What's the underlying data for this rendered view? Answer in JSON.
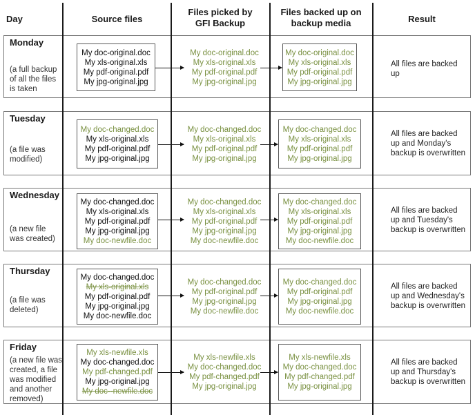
{
  "headers": {
    "day": "Day",
    "source": "Source files",
    "picked_line1": "Files picked by",
    "picked_line2": "GFI Backup",
    "backed_line1": "Files backed up on",
    "backed_line2": "backup media",
    "result": "Result"
  },
  "colors": {
    "unchanged": "#111111",
    "changed": "#7a9142",
    "border": "#777777"
  },
  "rows": [
    {
      "day": "Monday",
      "desc": [
        "(a full backup",
        "of all the files",
        "is taken"
      ],
      "source": [
        {
          "name": "My doc-original.doc",
          "state": "black"
        },
        {
          "name": "My xls-original.xls",
          "state": "black"
        },
        {
          "name": "My pdf-original.pdf",
          "state": "black"
        },
        {
          "name": "My jpg-original.jpg",
          "state": "black"
        }
      ],
      "picked": [
        "My doc-original.doc",
        "My xls-original.xls",
        "My pdf-original.pdf",
        "My jpg-original.jpg"
      ],
      "backed": [
        "My doc-original.doc",
        "My xls-original.xls",
        "My pdf-original.pdf",
        "My jpg-original.jpg"
      ],
      "result": [
        "All files are backed",
        "up"
      ]
    },
    {
      "day": "Tuesday",
      "desc": [
        "(a file was",
        "modified)"
      ],
      "source": [
        {
          "name": "My doc-changed.doc",
          "state": "green"
        },
        {
          "name": "My xls-original.xls",
          "state": "black"
        },
        {
          "name": "My pdf-original.pdf",
          "state": "black"
        },
        {
          "name": "My jpg-original.jpg",
          "state": "black"
        }
      ],
      "picked": [
        "My doc-changed.doc",
        "My xls-original.xls",
        "My pdf-original.pdf",
        "My jpg-original.jpg"
      ],
      "backed": [
        "My doc-changed.doc",
        "My xls-original.xls",
        "My pdf-original.pdf",
        "My jpg-original.jpg"
      ],
      "result": [
        "All files are backed",
        "up and Monday's",
        "backup is overwritten"
      ]
    },
    {
      "day": "Wednesday",
      "desc": [
        "(a new file",
        "was created)"
      ],
      "source": [
        {
          "name": "My doc-changed.doc",
          "state": "black"
        },
        {
          "name": "My xls-original.xls",
          "state": "black"
        },
        {
          "name": "My pdf-original.pdf",
          "state": "black"
        },
        {
          "name": "My jpg-original.jpg",
          "state": "black"
        },
        {
          "name": "My doc-newfile.doc",
          "state": "green"
        }
      ],
      "picked": [
        "My doc-changed.doc",
        "My xls-original.xls",
        "My pdf-original.pdf",
        "My jpg-original.jpg",
        "My doc-newfile.doc"
      ],
      "backed": [
        "My doc-changed.doc",
        "My xls-original.xls",
        "My pdf-original.pdf",
        "My jpg-original.jpg",
        "My doc-newfile.doc"
      ],
      "result": [
        "All files are backed",
        "up and Tuesday's",
        "backup is overwritten"
      ]
    },
    {
      "day": "Thursday",
      "desc": [
        "(a file was",
        "deleted)"
      ],
      "source": [
        {
          "name": "My doc-changed.doc",
          "state": "black"
        },
        {
          "name": "My xls-original.xls",
          "state": "struck"
        },
        {
          "name": "My pdf-original.pdf",
          "state": "black"
        },
        {
          "name": "My jpg-original.jpg",
          "state": "black"
        },
        {
          "name": "My doc-newfile.doc",
          "state": "black"
        }
      ],
      "picked": [
        "My doc-changed.doc",
        "My pdf-original.pdf",
        "My jpg-original.jpg",
        "My doc-newfile.doc"
      ],
      "backed": [
        "My doc-changed.doc",
        "My pdf-original.pdf",
        "My jpg-original.jpg",
        "My doc-newfile.doc"
      ],
      "result": [
        "All files are backed",
        "up and Wednesday's",
        "backup is overwritten"
      ]
    },
    {
      "day": "Friday",
      "desc": [
        "(a new file was",
        "created, a file",
        "was modified",
        "and another",
        "removed)"
      ],
      "source": [
        {
          "name": "My xls-newfile.xls",
          "state": "green"
        },
        {
          "name": "My doc-changed.doc",
          "state": "black"
        },
        {
          "name": "My pdf-changed.pdf",
          "state": "green"
        },
        {
          "name": "My jpg-original.jpg",
          "state": "black"
        },
        {
          "name": "My doc--newfile.doc",
          "state": "struck"
        }
      ],
      "picked": [
        "My xls-newfile.xls",
        "My doc-changed.doc",
        "My pdf-changed.pdf",
        "My jpg-original.jpg"
      ],
      "backed": [
        "My xls-newfile.xls",
        "My doc-changed.doc",
        "My pdf-changed.pdf",
        "My jpg-original.jpg"
      ],
      "result": [
        "All files are backed",
        "up and Thursday's",
        "backup is overwritten"
      ]
    }
  ]
}
